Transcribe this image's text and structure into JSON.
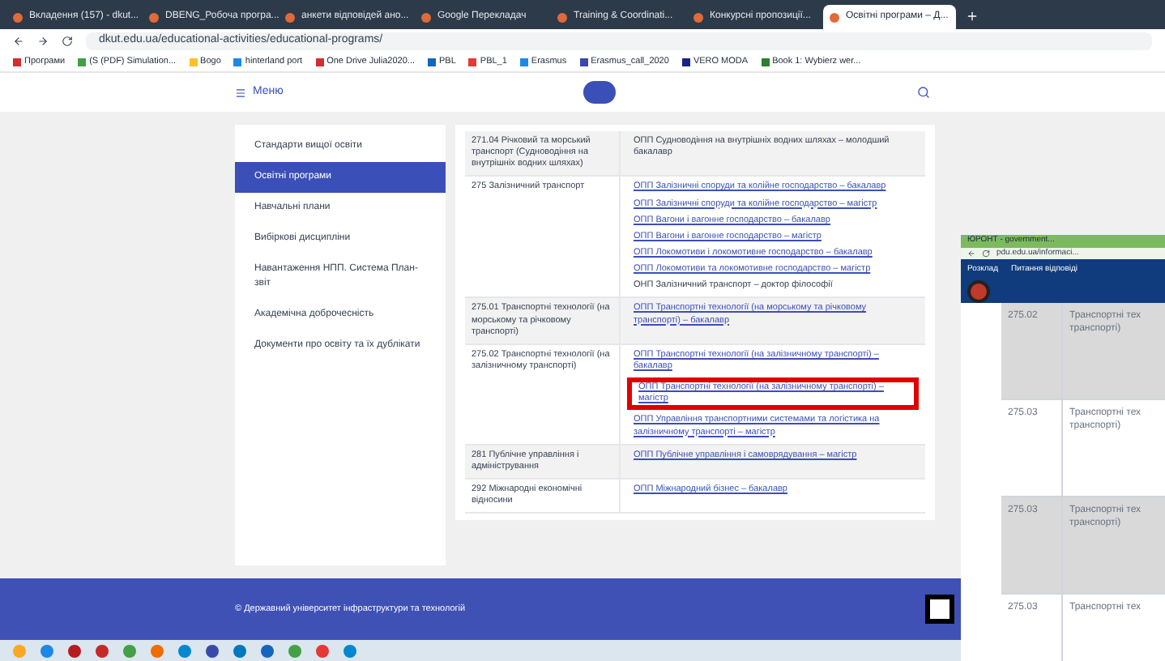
{
  "browser": {
    "tabs": [
      {
        "label": "Вкладення (157) - dkut...",
        "selected": false
      },
      {
        "label": "DBENG_Робоча програ...",
        "selected": false
      },
      {
        "label": "анкети відповідей ано...",
        "selected": false
      },
      {
        "label": "Google Перекладач",
        "selected": false
      },
      {
        "label": "Training & Coordinati...",
        "selected": false
      },
      {
        "label": "Конкурсні пропозиції...",
        "selected": false
      },
      {
        "label": "Освітні програми – Д...",
        "selected": true
      }
    ],
    "address": "dkut.edu.ua/educational-activities/educational-programs/",
    "bookmarks": [
      "Програми",
      "(S (PDF) Simulation...",
      "Bogo",
      "hinterland port",
      "One Drive Julia2020...",
      "PBL",
      "PBL_1",
      "Erasmus",
      "Erasmus_call_2020",
      "VERO MODA",
      "Book 1: Wybierz wer..."
    ]
  },
  "header": {
    "menu": "Меню"
  },
  "sidebar": {
    "items": [
      {
        "label": "Стандарти вищої освіти",
        "selected": false
      },
      {
        "label": "Освітні програми",
        "selected": true
      },
      {
        "label": "Навчальні плани",
        "selected": false
      },
      {
        "label": "Вибіркові дисципліни",
        "selected": false
      },
      {
        "label": "Навантаження НПП. Система План-звіт",
        "selected": false
      },
      {
        "label": "Академічна доброчесність",
        "selected": false
      },
      {
        "label": "Документи про освіту та їх дублікати",
        "selected": false
      }
    ]
  },
  "table": {
    "rows": [
      {
        "specialty": "271.04 Річковий та морський транспорт (Судноводіння на внутрішніх водних шляхах)",
        "programs": [
          {
            "kind": "text",
            "label": "ОПП Судноводіння на внутрішніх водних шляхах – молодший бакалавр",
            "highlighted": false
          }
        ]
      },
      {
        "specialty": "275 Залізничний транспорт",
        "programs": [
          {
            "kind": "link",
            "label": "ОПП Залізничні споруди та колійне господарство – бакалавр",
            "highlighted": false
          },
          {
            "kind": "link",
            "label": "ОПП Залізничні споруди та колійне господарство – магістр",
            "highlighted": false
          },
          {
            "kind": "link",
            "label": "ОПП Вагони і вагонне господарство – бакалавр",
            "highlighted": false
          },
          {
            "kind": "link",
            "label": "ОПП Вагони і вагонне господарство – магістр",
            "highlighted": false
          },
          {
            "kind": "link",
            "label": "ОПП Локомотиви і локомотивне господарство – бакалавр",
            "highlighted": false
          },
          {
            "kind": "link",
            "label": "ОПП Локомотиви та локомотивне господарство – магістр",
            "highlighted": false
          },
          {
            "kind": "text",
            "label": "ОНП Залізничний транспорт – доктор філософії",
            "highlighted": false
          }
        ]
      },
      {
        "specialty": "275.01 Транспортні технології (на морському та річковому транспорті)",
        "programs": [
          {
            "kind": "link",
            "label": "ОПП Транспортні технології (на морському та річковому транспорті) – бакалавр",
            "highlighted": false
          }
        ]
      },
      {
        "specialty": "275.02 Транспортні технології (на залізничному транспорті)",
        "programs": [
          {
            "kind": "link",
            "label": "ОПП Транспортні технології (на залізничному транспорті) – бакалавр",
            "highlighted": false
          },
          {
            "kind": "link",
            "label": "ОПП Транспортні технології (на залізничному транспорті) – магістр",
            "highlighted": true
          },
          {
            "kind": "link",
            "label": "ОПП Управління транспортними системами та логістика на залізничному транспорті – магістр",
            "highlighted": false
          }
        ]
      },
      {
        "specialty": "281 Публічне управління і адміністрування",
        "programs": [
          {
            "kind": "link",
            "label": "ОПП Публічне управління і самоврядування – магістр",
            "highlighted": false
          }
        ]
      },
      {
        "specialty": "292 Міжнародні економічні відносини",
        "programs": [
          {
            "kind": "link",
            "label": "ОПП Міжнародний бізнес – бакалавр",
            "highlighted": false
          }
        ]
      }
    ]
  },
  "footer": {
    "text": "© Державний університет інфраструктури та технологій"
  },
  "second_window": {
    "tab": "ЮРОНТ - government...",
    "address": "pdu.edu.ua/informaci...",
    "nav": [
      "Розклад",
      "Питання відповіді"
    ],
    "rows": [
      {
        "code": "275.02",
        "name": "Транспортні тех",
        "name_2": "транспорті)"
      },
      {
        "code": "275.03",
        "name": "Транспортні тех",
        "name_2": "транспорті)"
      },
      {
        "code": "275.03",
        "name": "Транспортні тех",
        "name_2": "транспорті)"
      },
      {
        "code": "275.03",
        "name": "Транспортні тех"
      }
    ]
  }
}
